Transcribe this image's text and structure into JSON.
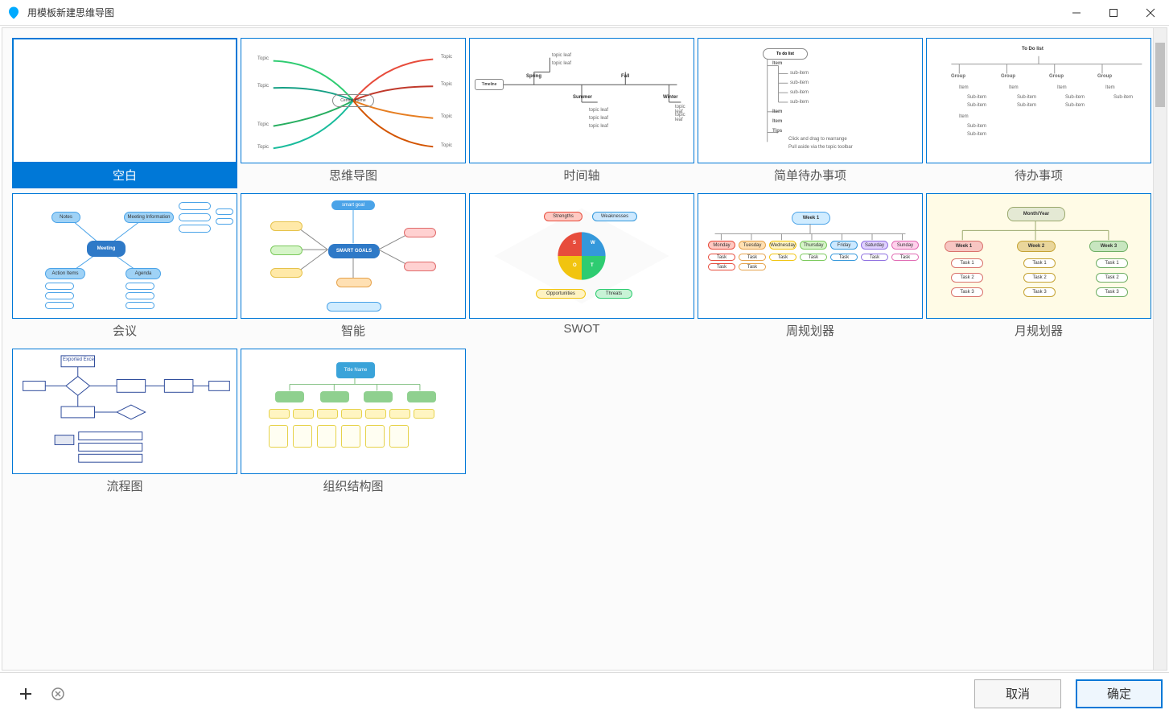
{
  "window": {
    "title": "用模板新建思维导图"
  },
  "templates": [
    {
      "id": "blank",
      "label": "空白",
      "selected": true
    },
    {
      "id": "mindmap",
      "label": "思维导图",
      "selected": false
    },
    {
      "id": "timeline",
      "label": "时间轴",
      "selected": false
    },
    {
      "id": "simple-todo",
      "label": "简单待办事项",
      "selected": false
    },
    {
      "id": "todo",
      "label": "待办事项",
      "selected": false
    },
    {
      "id": "meeting",
      "label": "会议",
      "selected": false
    },
    {
      "id": "smart",
      "label": "智能",
      "selected": false
    },
    {
      "id": "swot",
      "label": "SWOT",
      "selected": false
    },
    {
      "id": "week-plan",
      "label": "周规划器",
      "selected": false
    },
    {
      "id": "month-plan",
      "label": "月规划器",
      "selected": false
    },
    {
      "id": "flowchart",
      "label": "流程图",
      "selected": false
    },
    {
      "id": "orgchart",
      "label": "组织结构图",
      "selected": false
    }
  ],
  "preview_text": {
    "mindmap_center": "Central theme",
    "mindmap_branch": "Topic",
    "timeline_root": "Timeline",
    "timeline_spring": "Spring",
    "timeline_summer": "Summer",
    "timeline_fall": "Fall",
    "timeline_winter": "Winter",
    "timeline_leaf": "topic leaf",
    "simple_todo_title": "To do list",
    "simple_todo_item": "Item",
    "simple_todo_sub": "sub-item",
    "simple_todo_tips": "Tips",
    "simple_todo_tip1": "Click and drag to rearrange",
    "simple_todo_tip2": "Pull aside via the topic toolbar",
    "todo_title": "To Do list",
    "todo_group": "Group",
    "todo_item": "Item",
    "todo_sub": "Sub-item",
    "meeting_root": "Meeting",
    "meeting_info": "Meeting Information",
    "meeting_notes": "Notes",
    "meeting_actions": "Action Items",
    "meeting_agenda": "Agenda",
    "smart_center": "SMART GOALS",
    "smart_goal": "smart goal",
    "swot_s": "S",
    "swot_w": "W",
    "swot_o": "O",
    "swot_t": "T",
    "swot_strengths": "Strengths",
    "swot_weaknesses": "Weaknesses",
    "swot_opportunities": "Opportunities",
    "swot_threats": "Threats",
    "week_root": "Week 1",
    "week_mon": "Monday",
    "week_tue": "Tuesday",
    "week_wed": "Wednesday",
    "week_thu": "Thursday",
    "week_fri": "Friday",
    "week_sat": "Saturday",
    "week_sun": "Sunday",
    "week_task": "Task",
    "month_root": "Month/Year",
    "month_w1": "Week 1",
    "month_w2": "Week 2",
    "month_w3": "Week 3",
    "month_task1": "Task 1",
    "month_task2": "Task 2",
    "month_task3": "Task 3",
    "flow_start": "Exported Excel",
    "org_root": "Title Name"
  },
  "footer": {
    "cancel": "取消",
    "ok": "确定"
  }
}
